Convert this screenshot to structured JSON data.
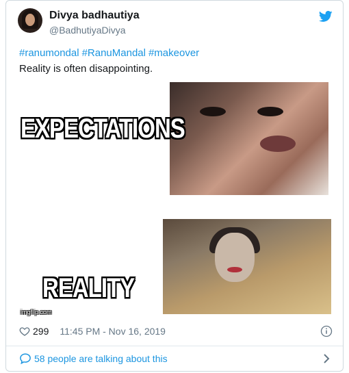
{
  "tweet": {
    "author": {
      "display_name": "Divya badhautiya",
      "handle": "@BadhutiyaDivya"
    },
    "hashtags": [
      "#ranumondal",
      "#RanuMandal",
      "#makeover"
    ],
    "text": "Reality is often disappointing.",
    "meme": {
      "top_label": "EXPECTATIONS",
      "bottom_label": "REALITY",
      "watermark": "imgflip.com"
    },
    "likes": "299",
    "timestamp": "11:45 PM - Nov 16, 2019",
    "talking": "58 people are talking about this"
  },
  "icons": {
    "brand": "twitter-bird-icon",
    "like": "heart-icon",
    "info": "info-icon",
    "talk": "speech-bubble-icon",
    "more": "chevron-right-icon"
  },
  "colors": {
    "accent": "#1b95e0",
    "muted": "#657786",
    "border": "#cfd9de"
  }
}
